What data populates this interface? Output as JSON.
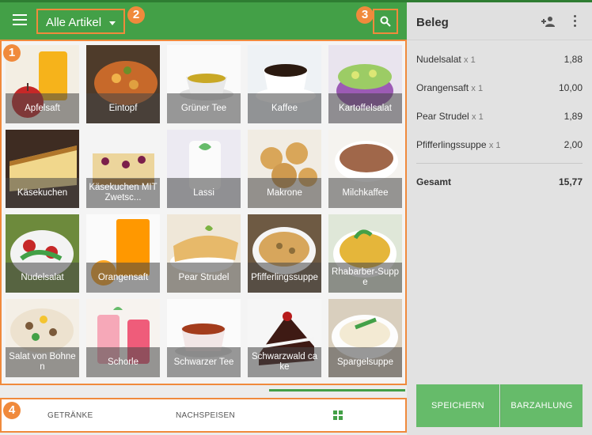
{
  "header": {
    "category_label": "Alle Artikel"
  },
  "markers": [
    "1",
    "2",
    "3",
    "4"
  ],
  "products": [
    {
      "name": "Apfelsaft"
    },
    {
      "name": "Eintopf"
    },
    {
      "name": "Grüner Tee"
    },
    {
      "name": "Kaffee"
    },
    {
      "name": "Kartoffelsalat"
    },
    {
      "name": "Käsekuchen"
    },
    {
      "name": "Käsekuchen MIT Zwetsc..."
    },
    {
      "name": "Lassi"
    },
    {
      "name": "Makrone"
    },
    {
      "name": "Milchkaffee"
    },
    {
      "name": "Nudelsalat"
    },
    {
      "name": "Orangensaft"
    },
    {
      "name": "Pear Strudel"
    },
    {
      "name": "Pfifferlingssuppe"
    },
    {
      "name": "Rhabarber-Suppe"
    },
    {
      "name": "Salat von Bohnen"
    },
    {
      "name": "Schorle"
    },
    {
      "name": "Schwarzer Tee"
    },
    {
      "name": "Schwarzwald cake"
    },
    {
      "name": "Spargelsuppe"
    }
  ],
  "bottom_nav": {
    "getraenke": "GETRÄNKE",
    "nachspeisen": "NACHSPEISEN"
  },
  "receipt": {
    "title": "Beleg",
    "lines": [
      {
        "name": "Nudelsalat",
        "qty": "x 1",
        "price": "1,88"
      },
      {
        "name": "Orangensaft",
        "qty": "x 1",
        "price": "10,00"
      },
      {
        "name": "Pear Strudel",
        "qty": "x 1",
        "price": "1,89"
      },
      {
        "name": "Pfifferlingssuppe",
        "qty": "x 1",
        "price": "2,00"
      }
    ],
    "total_label": "Gesamt",
    "total_value": "15,77"
  },
  "actions": {
    "save": "SPEICHERN",
    "cash": "BARZAHLUNG"
  },
  "colors": {
    "appbar": "#43a047",
    "accent_marker": "#f08a3c",
    "button": "#66bb6a"
  }
}
